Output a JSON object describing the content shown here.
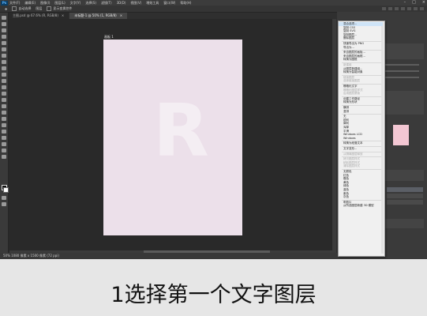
{
  "menubar": {
    "logo": "Ps",
    "items": [
      "文件(F)",
      "编辑(E)",
      "图像(I)",
      "图层(L)",
      "文字(Y)",
      "选择(S)",
      "滤镜(T)",
      "3D(D)",
      "视图(V)",
      "增效工具",
      "窗口(W)",
      "帮助(H)"
    ],
    "window_controls": [
      "–",
      "□",
      "×"
    ]
  },
  "optbar": {
    "auto_select": "自动选择",
    "layer_select": "图层",
    "show_transform": "显示变换控件"
  },
  "tabs": [
    {
      "label": "主图.psd @ 67.6% (R, RGB/8)",
      "close": "×"
    },
    {
      "label": "未标题-1 @ 50% (1, RGB/8)",
      "close": "×"
    }
  ],
  "artboard": {
    "label": "画板 1",
    "letter": "R"
  },
  "statusbar": {
    "text": "50%    1080 像素 x 1500 像素 (72 ppi)"
  },
  "context_menu": {
    "items": [
      {
        "label": "混合选项...",
        "state": "highlight"
      },
      {
        "label": "复制 CSS",
        "state": "normal"
      },
      {
        "label": "复制 SVG",
        "state": "normal"
      },
      {
        "label": "复制图层...",
        "state": "normal"
      },
      {
        "label": "删除图层",
        "state": "normal"
      },
      {
        "sep": true
      },
      {
        "label": "快速导出为 PNG",
        "state": "normal"
      },
      {
        "label": "导出为...",
        "state": "normal"
      },
      {
        "sep": true
      },
      {
        "label": "来自图层的画板...",
        "state": "normal"
      },
      {
        "label": "来自图层的画框...",
        "state": "normal"
      },
      {
        "label": "转换为图框",
        "state": "normal"
      },
      {
        "sep": true
      },
      {
        "label": "新建组",
        "state": "dis"
      },
      {
        "label": "从图层新建组...",
        "state": "normal"
      },
      {
        "label": "转换为智能对象",
        "state": "normal"
      },
      {
        "sep": true
      },
      {
        "label": "链接图层",
        "state": "dis"
      },
      {
        "label": "选择链接图层",
        "state": "dis"
      },
      {
        "sep": true
      },
      {
        "label": "栅格化文字",
        "state": "normal"
      },
      {
        "label": "栅格化图层样式",
        "state": "dis"
      },
      {
        "label": "启用图层蒙版",
        "state": "dis"
      },
      {
        "sep": true
      },
      {
        "label": "创建工作路径",
        "state": "normal"
      },
      {
        "label": "转换为形状",
        "state": "normal"
      },
      {
        "sep": true
      },
      {
        "label": "横排",
        "state": "normal"
      },
      {
        "label": "竖排",
        "state": "normal"
      },
      {
        "sep": true
      },
      {
        "label": "无",
        "state": "normal"
      },
      {
        "label": "锐利",
        "state": "normal"
      },
      {
        "label": "犀利",
        "state": "normal"
      },
      {
        "label": "浑厚",
        "state": "normal"
      },
      {
        "label": "平滑",
        "state": "normal"
      },
      {
        "label": "Windows LCD",
        "state": "normal"
      },
      {
        "label": "Windows",
        "state": "normal"
      },
      {
        "sep": true
      },
      {
        "label": "转换为段落文本",
        "state": "normal"
      },
      {
        "sep": true
      },
      {
        "label": "文字变形...",
        "state": "normal"
      },
      {
        "sep": true
      },
      {
        "label": "从隔离图层释放",
        "state": "dis"
      },
      {
        "sep": true
      },
      {
        "label": "拷贝图层样式",
        "state": "dis"
      },
      {
        "label": "粘贴图层样式",
        "state": "dis"
      },
      {
        "label": "清除图层样式",
        "state": "dis"
      },
      {
        "sep": true
      },
      {
        "label": "无颜色",
        "state": "normal"
      },
      {
        "label": "红色",
        "state": "normal"
      },
      {
        "label": "橙色",
        "state": "normal"
      },
      {
        "label": "黄色",
        "state": "normal"
      },
      {
        "label": "绿色",
        "state": "normal"
      },
      {
        "label": "蓝色",
        "state": "normal"
      },
      {
        "label": "紫色",
        "state": "normal"
      },
      {
        "label": "灰色",
        "state": "normal"
      },
      {
        "sep": true
      },
      {
        "label": "明信片",
        "state": "normal"
      },
      {
        "label": "从所选图层新建 3D 模型",
        "state": "normal"
      }
    ]
  },
  "caption": "1选择第一个文字图层",
  "colors": {
    "app_bg": "#2f2f2f",
    "artboard": "#ece0ea",
    "menu_highlight": "#cfe4f7",
    "caption_bg": "#e6e6e6"
  }
}
